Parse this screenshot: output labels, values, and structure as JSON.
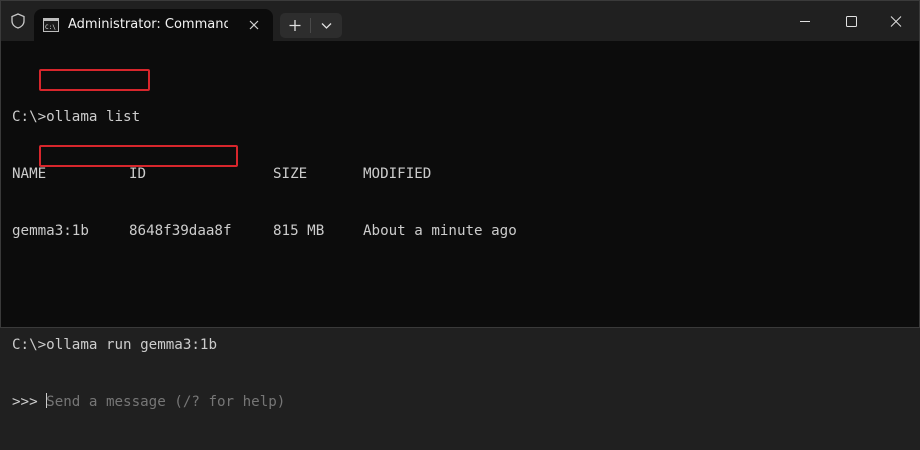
{
  "titlebar": {
    "tab_title": "Administrator: Command Pro"
  },
  "terminal": {
    "cmd1_prefix": "C:\\",
    "cmd1_text": ">ollama list",
    "table_headers": [
      "NAME",
      "ID",
      "SIZE",
      "MODIFIED"
    ],
    "table_rows": [
      [
        "gemma3:1b",
        "8648f39daa8f",
        "815 MB",
        "About a minute ago"
      ]
    ],
    "cmd2_prefix": "C:\\",
    "cmd2_text": ">ollama run gemma3:1b",
    "prompt_marker": ">>> ",
    "prompt_placeholder": "Send a message (/? for help)"
  },
  "colors": {
    "background": "#0c0c0c",
    "titlebar": "#202020",
    "text": "#cccccc",
    "highlight_box": "#d7262c"
  },
  "icons": {
    "shield": "shield-icon",
    "tab": "command-prompt-icon",
    "close_tab": "close-icon",
    "new_tab": "plus-icon",
    "dropdown": "chevron-down-icon",
    "minimize": "minimize-icon",
    "maximize": "maximize-icon",
    "close_window": "close-icon"
  }
}
